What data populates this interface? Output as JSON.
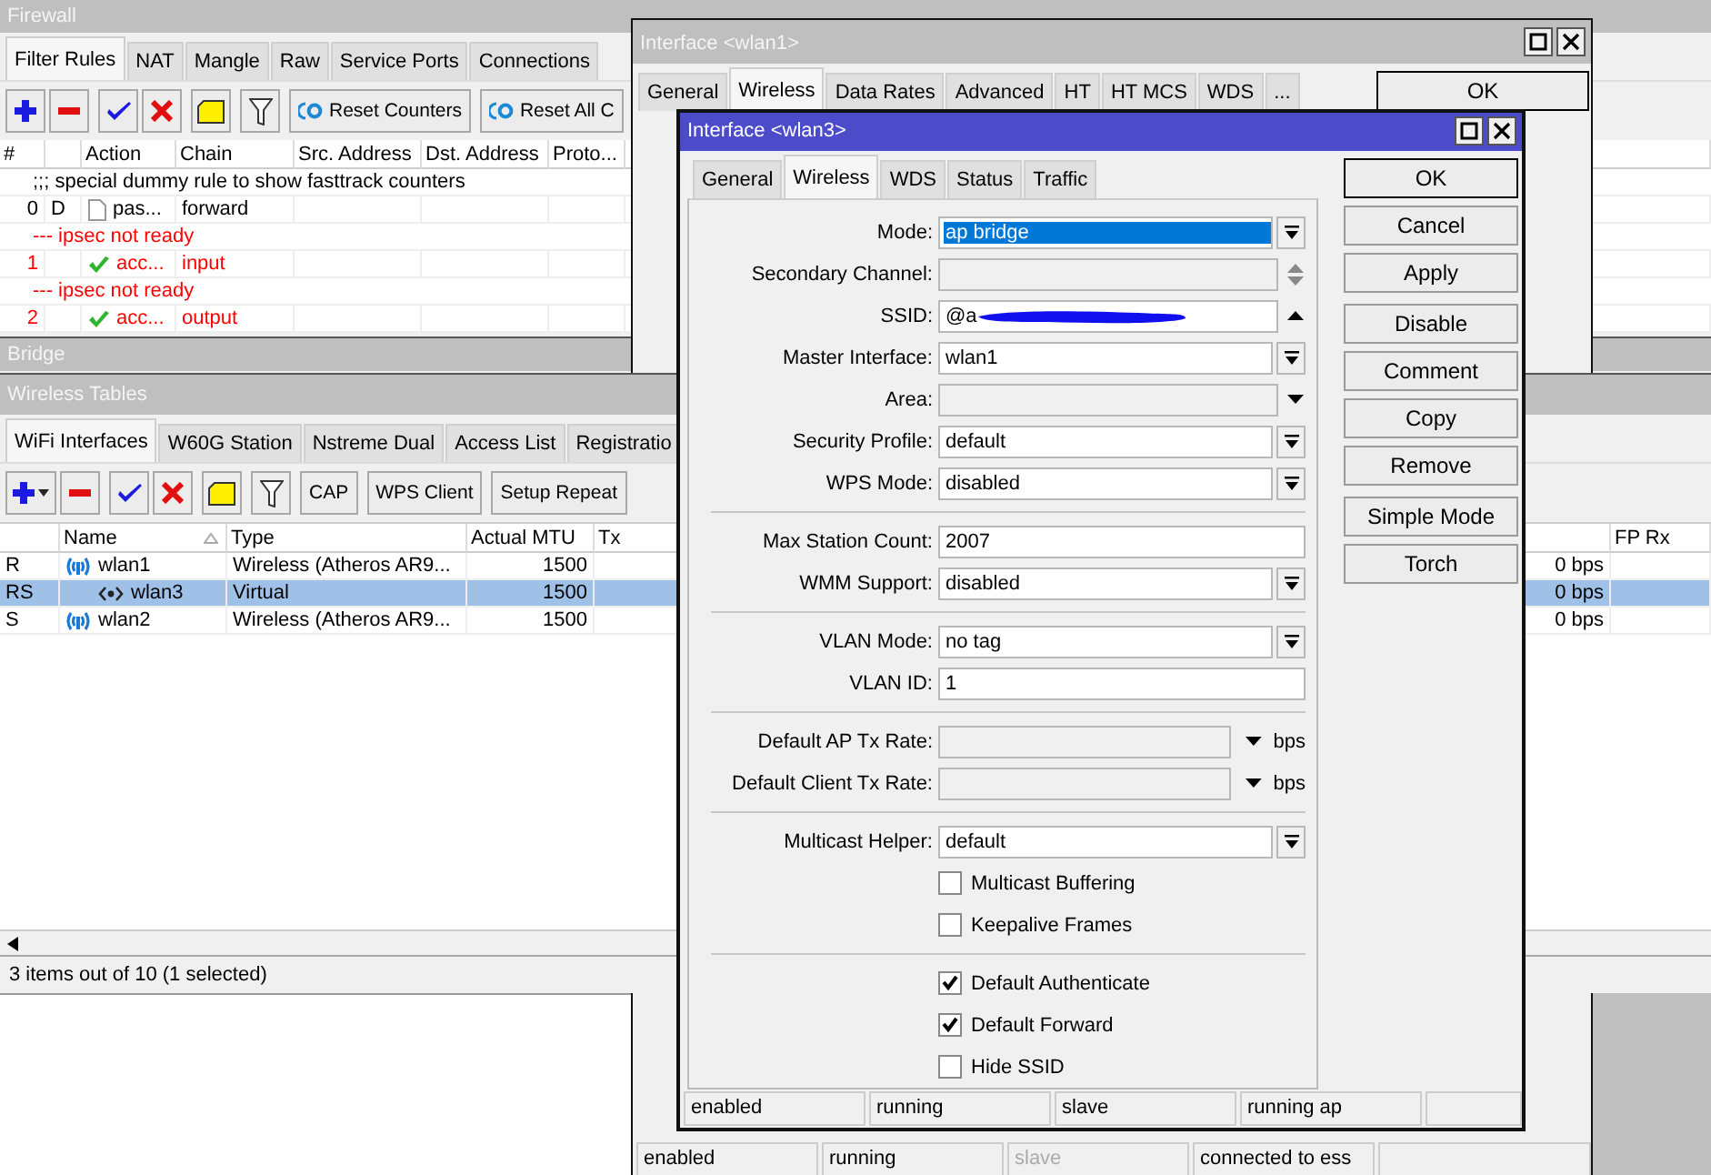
{
  "firewall": {
    "title": "Firewall",
    "tabs": [
      {
        "label": "Filter Rules",
        "selected": true
      },
      {
        "label": "NAT",
        "selected": false
      },
      {
        "label": "Mangle",
        "selected": false
      },
      {
        "label": "Raw",
        "selected": false
      },
      {
        "label": "Service Ports",
        "selected": false
      },
      {
        "label": "Connections",
        "selected": false
      }
    ],
    "toolbar": [
      "Reset Counters",
      "Reset All C"
    ],
    "columns": [
      "#",
      "Action",
      "Chain",
      "Src. Address",
      "Dst. Address",
      "Proto..."
    ],
    "rows": [
      {
        "kind": "comment",
        "text": ";;; special dummy rule to show fasttrack counters",
        "warning": false
      },
      {
        "kind": "passthrough",
        "number": "0",
        "flag": "D",
        "action": "pas...",
        "chain": "forward",
        "warning": false
      },
      {
        "kind": "comment",
        "text": "--- ipsec not ready",
        "warning": true
      },
      {
        "kind": "accept",
        "number": "1",
        "action": "acc...",
        "chain": "input",
        "warning": true
      },
      {
        "kind": "comment",
        "text": "--- ipsec not ready",
        "warning": true
      },
      {
        "kind": "accept",
        "number": "2",
        "action": "acc...",
        "chain": "output",
        "warning": true
      }
    ]
  },
  "bridge": {
    "title": "Bridge"
  },
  "wireless": {
    "title": "Wireless Tables",
    "tabs": [
      {
        "label": "WiFi Interfaces",
        "selected": true
      },
      {
        "label": "W60G Station",
        "selected": false
      },
      {
        "label": "Nstreme Dual",
        "selected": false
      },
      {
        "label": "Access List",
        "selected": false
      },
      {
        "label": "Registratio",
        "selected": false
      }
    ],
    "toolbar": [
      "CAP",
      "WPS Client",
      "Setup Repeat"
    ],
    "columns": [
      "Name",
      "Type",
      "Actual MTU",
      "Tx",
      "FP Rx"
    ],
    "rows": [
      {
        "flag": "R",
        "name": "wlan1",
        "kind": "wireless",
        "type": "Wireless (Atheros AR9...",
        "mtu": "1500",
        "column_6": "0 bps",
        "selected": false,
        "children": [
          {
            "flag": "RS",
            "name": "wlan3",
            "kind": "virtual",
            "type": "Virtual",
            "mtu": "1500",
            "column_6": "0 bps",
            "selected": true
          }
        ]
      },
      {
        "flag": "S",
        "name": "wlan2",
        "kind": "wireless",
        "type": "Wireless (Atheros AR9...",
        "mtu": "1500",
        "column_6": "0 bps",
        "selected": false
      }
    ],
    "status": "3 items out of 10 (1 selected)"
  },
  "interface_wlan1": {
    "title": "Interface <wlan1>",
    "tabs": [
      {
        "label": "General",
        "selected": false
      },
      {
        "label": "Wireless",
        "selected": true
      },
      {
        "label": "Data Rates",
        "selected": false
      },
      {
        "label": "Advanced",
        "selected": false
      },
      {
        "label": "HT",
        "selected": false
      },
      {
        "label": "HT MCS",
        "selected": false
      },
      {
        "label": "WDS",
        "selected": false
      },
      {
        "label": "...",
        "selected": false
      }
    ],
    "buttons": [
      "OK"
    ],
    "status": [
      {
        "text": "enabled",
        "disabled": false
      },
      {
        "text": "running",
        "disabled": false
      },
      {
        "text": "slave",
        "disabled": true
      },
      {
        "text": "connected to ess",
        "disabled": false
      }
    ]
  },
  "interface_wlan3": {
    "title": "Interface <wlan3>",
    "tabs": [
      {
        "label": "General",
        "selected": false
      },
      {
        "label": "Wireless",
        "selected": true
      },
      {
        "label": "WDS",
        "selected": false
      },
      {
        "label": "Status",
        "selected": false
      },
      {
        "label": "Traffic",
        "selected": false
      }
    ],
    "groups": [
      [
        {
          "kind": "select",
          "label": "Mode:",
          "value": "ap bridge",
          "selected": true,
          "disabled": false
        },
        {
          "kind": "updown",
          "label": "Secondary Channel:",
          "disabled": true
        },
        {
          "kind": "combo-up",
          "label": "SSID:",
          "value": "@a",
          "redacted": true,
          "disabled": false
        },
        {
          "kind": "select",
          "label": "Master Interface:",
          "value": "wlan1",
          "selected": false,
          "disabled": false
        },
        {
          "kind": "combo-down",
          "label": "Area:",
          "disabled": true
        },
        {
          "kind": "select",
          "label": "Security Profile:",
          "value": "default",
          "selected": false,
          "disabled": false
        },
        {
          "kind": "select",
          "label": "WPS Mode:",
          "value": "disabled",
          "selected": false,
          "disabled": false
        }
      ],
      [
        {
          "kind": "text",
          "label": "Max Station Count:",
          "value": "2007",
          "disabled": false
        },
        {
          "kind": "select",
          "label": "WMM Support:",
          "value": "disabled",
          "selected": false,
          "disabled": false
        }
      ],
      [
        {
          "kind": "select",
          "label": "VLAN Mode:",
          "value": "no tag",
          "selected": false,
          "disabled": false
        },
        {
          "kind": "text",
          "label": "VLAN ID:",
          "value": "1",
          "disabled": false
        }
      ],
      [
        {
          "kind": "rate",
          "label": "Default AP Tx Rate:",
          "unit": "bps",
          "disabled": true
        },
        {
          "kind": "rate",
          "label": "Default Client Tx Rate:",
          "unit": "bps",
          "disabled": true
        }
      ],
      [
        {
          "kind": "select",
          "label": "Multicast Helper:",
          "value": "default",
          "selected": false,
          "disabled": false
        },
        {
          "kind": "checkbox",
          "label": "Multicast Buffering",
          "checked": false
        },
        {
          "kind": "checkbox",
          "label": "Keepalive Frames",
          "checked": false
        }
      ],
      [
        {
          "kind": "checkbox",
          "label": "Default Authenticate",
          "checked": true
        },
        {
          "kind": "checkbox",
          "label": "Default Forward",
          "checked": true
        },
        {
          "kind": "checkbox",
          "label": "Hide SSID",
          "checked": false
        }
      ]
    ],
    "buttons": [
      [
        {
          "label": "OK",
          "default": true
        },
        {
          "label": "Cancel",
          "default": false
        },
        {
          "label": "Apply",
          "default": false
        }
      ],
      [
        {
          "label": "Disable",
          "default": false
        },
        {
          "label": "Comment",
          "default": false
        },
        {
          "label": "Copy",
          "default": false
        },
        {
          "label": "Remove",
          "default": false
        }
      ],
      [
        {
          "label": "Simple Mode",
          "default": false
        },
        {
          "label": "Torch",
          "default": false
        }
      ]
    ],
    "status": [
      {
        "text": "enabled",
        "disabled": false
      },
      {
        "text": "running",
        "disabled": false
      },
      {
        "text": "slave",
        "disabled": false
      },
      {
        "text": "running ap",
        "disabled": false
      }
    ]
  }
}
